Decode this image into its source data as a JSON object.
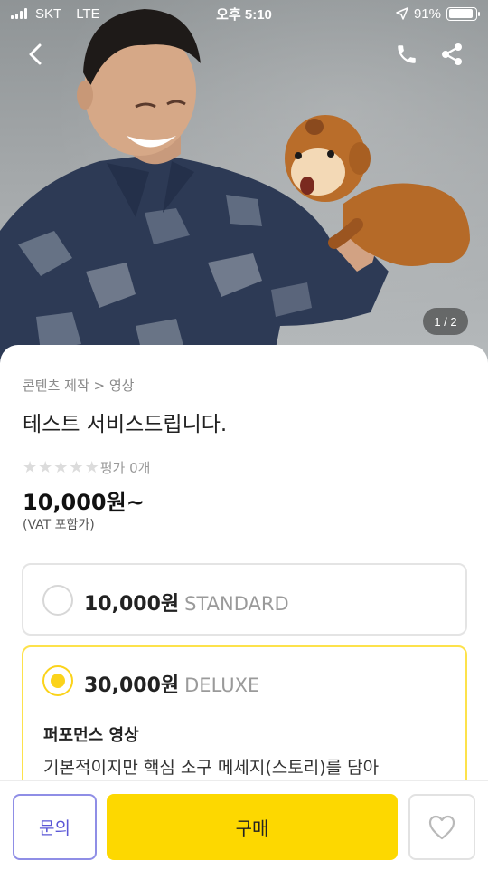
{
  "status_bar": {
    "carrier": "SKT",
    "network": "LTE",
    "time": "오후 5:10",
    "battery": "91%",
    "battery_level": 0.91,
    "icons": [
      "signal-icon",
      "location-arrow-icon",
      "battery-icon"
    ]
  },
  "nav": {
    "icons": [
      "back-arrow-icon",
      "phone-icon",
      "share-icon"
    ]
  },
  "gallery": {
    "counter": "1 / 2"
  },
  "product": {
    "breadcrumb": "콘텐츠 제작 > 영상",
    "title": "테스트 서비스드립니다.",
    "rating_stars": 0,
    "rating_label": "평가 0개",
    "price": "10,000원~",
    "vat_note": "(VAT 포함가)"
  },
  "options": [
    {
      "price": "10,000원",
      "grade": "STANDARD",
      "selected": false
    },
    {
      "price": "30,000원",
      "grade": "DELUXE",
      "selected": true,
      "subtitle": "퍼포먼스 영상",
      "description": "기본적이지만 핵심 소구 메세지(스토리)를 담아"
    }
  ],
  "bottom_bar": {
    "inquiry_label": "문의",
    "buy_label": "구매",
    "like_icon": "heart-icon"
  },
  "colors": {
    "accent_yellow": "#fdd800",
    "radio_yellow": "#fbd31b",
    "inquiry_purple": "#5b57d6",
    "inquiry_border": "#8f8ee6"
  }
}
